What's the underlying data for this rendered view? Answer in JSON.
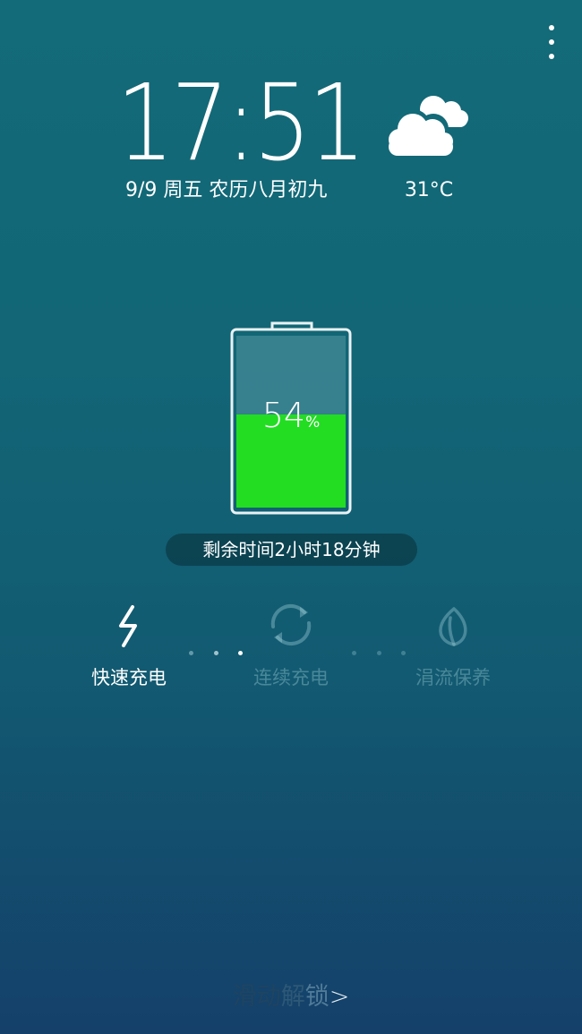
{
  "lockscreen": {
    "time": "17:51",
    "date": "9/9  周五 农历八月初九",
    "weather": {
      "icon": "cloud-icon",
      "temperature": "31°C"
    },
    "battery": {
      "level_percent": 54,
      "number": "54",
      "percent_sign": "%",
      "fill_color": "#22dd22"
    },
    "remaining_time": "剩余时间2小时18分钟",
    "charge_modes": [
      {
        "label": "快速充电",
        "icon": "lightning-icon",
        "active": true
      },
      {
        "label": "连续充电",
        "icon": "refresh-icon",
        "active": false
      },
      {
        "label": "涓流保养",
        "icon": "leaf-icon",
        "active": false
      }
    ],
    "unlock": {
      "chars": [
        "滑",
        "动",
        "解",
        "锁"
      ],
      "arrow": ">"
    }
  }
}
